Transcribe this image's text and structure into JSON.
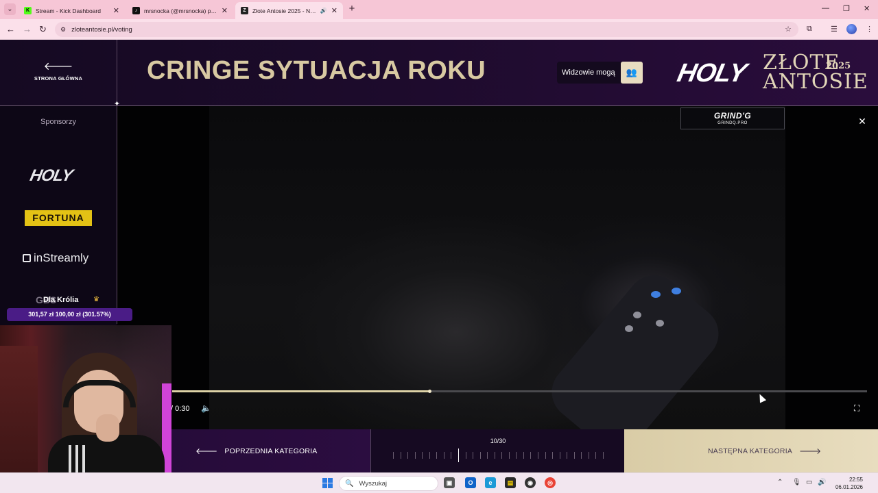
{
  "browser": {
    "tabs": [
      {
        "title": "Stream - Kick Dashboard",
        "favicon": "kick-icon"
      },
      {
        "title": "mrsnocka (@mrsnocka) prowadzi…",
        "favicon": "tiktok-icon"
      },
      {
        "title": "Złote Antosie 2025 - Najwię…",
        "favicon": "antosie-icon",
        "active": true,
        "audio": true
      }
    ],
    "url": "zloteantosie.pl/voting"
  },
  "header": {
    "back_label": "STRONA GŁÓWNA",
    "category_title": "CRINGE SYTUACJA ROKU",
    "viewers_label": "Widzowie mogą",
    "brand_holy": "HOLY",
    "brand_line1": "ZŁOTE",
    "brand_line2": "ANTOSIE",
    "brand_year": "2025"
  },
  "sidebar": {
    "sponsors_label": "Sponsorzy",
    "sponsors": [
      "HOLY",
      "FORTUNA",
      "inStreamly",
      "GBS"
    ]
  },
  "video": {
    "badge_title": "GRIND'G",
    "badge_sub": "GRINDQ.PRO",
    "time": "/ 0:30",
    "progress_fraction": 0.37
  },
  "bottom": {
    "prev_label": "POPRZEDNIA KATEGORIA",
    "next_label": "NASTĘPNA KATEGORIA",
    "counter": "10/30",
    "current_index": 10,
    "total": 30
  },
  "donation": {
    "title": "Dla Królia",
    "amount_text": "301,57 zł   100,00 zł (301.57%)"
  },
  "taskbar": {
    "search_placeholder": "Wyszukaj",
    "time": "22:55",
    "date": "06.01.2026"
  }
}
